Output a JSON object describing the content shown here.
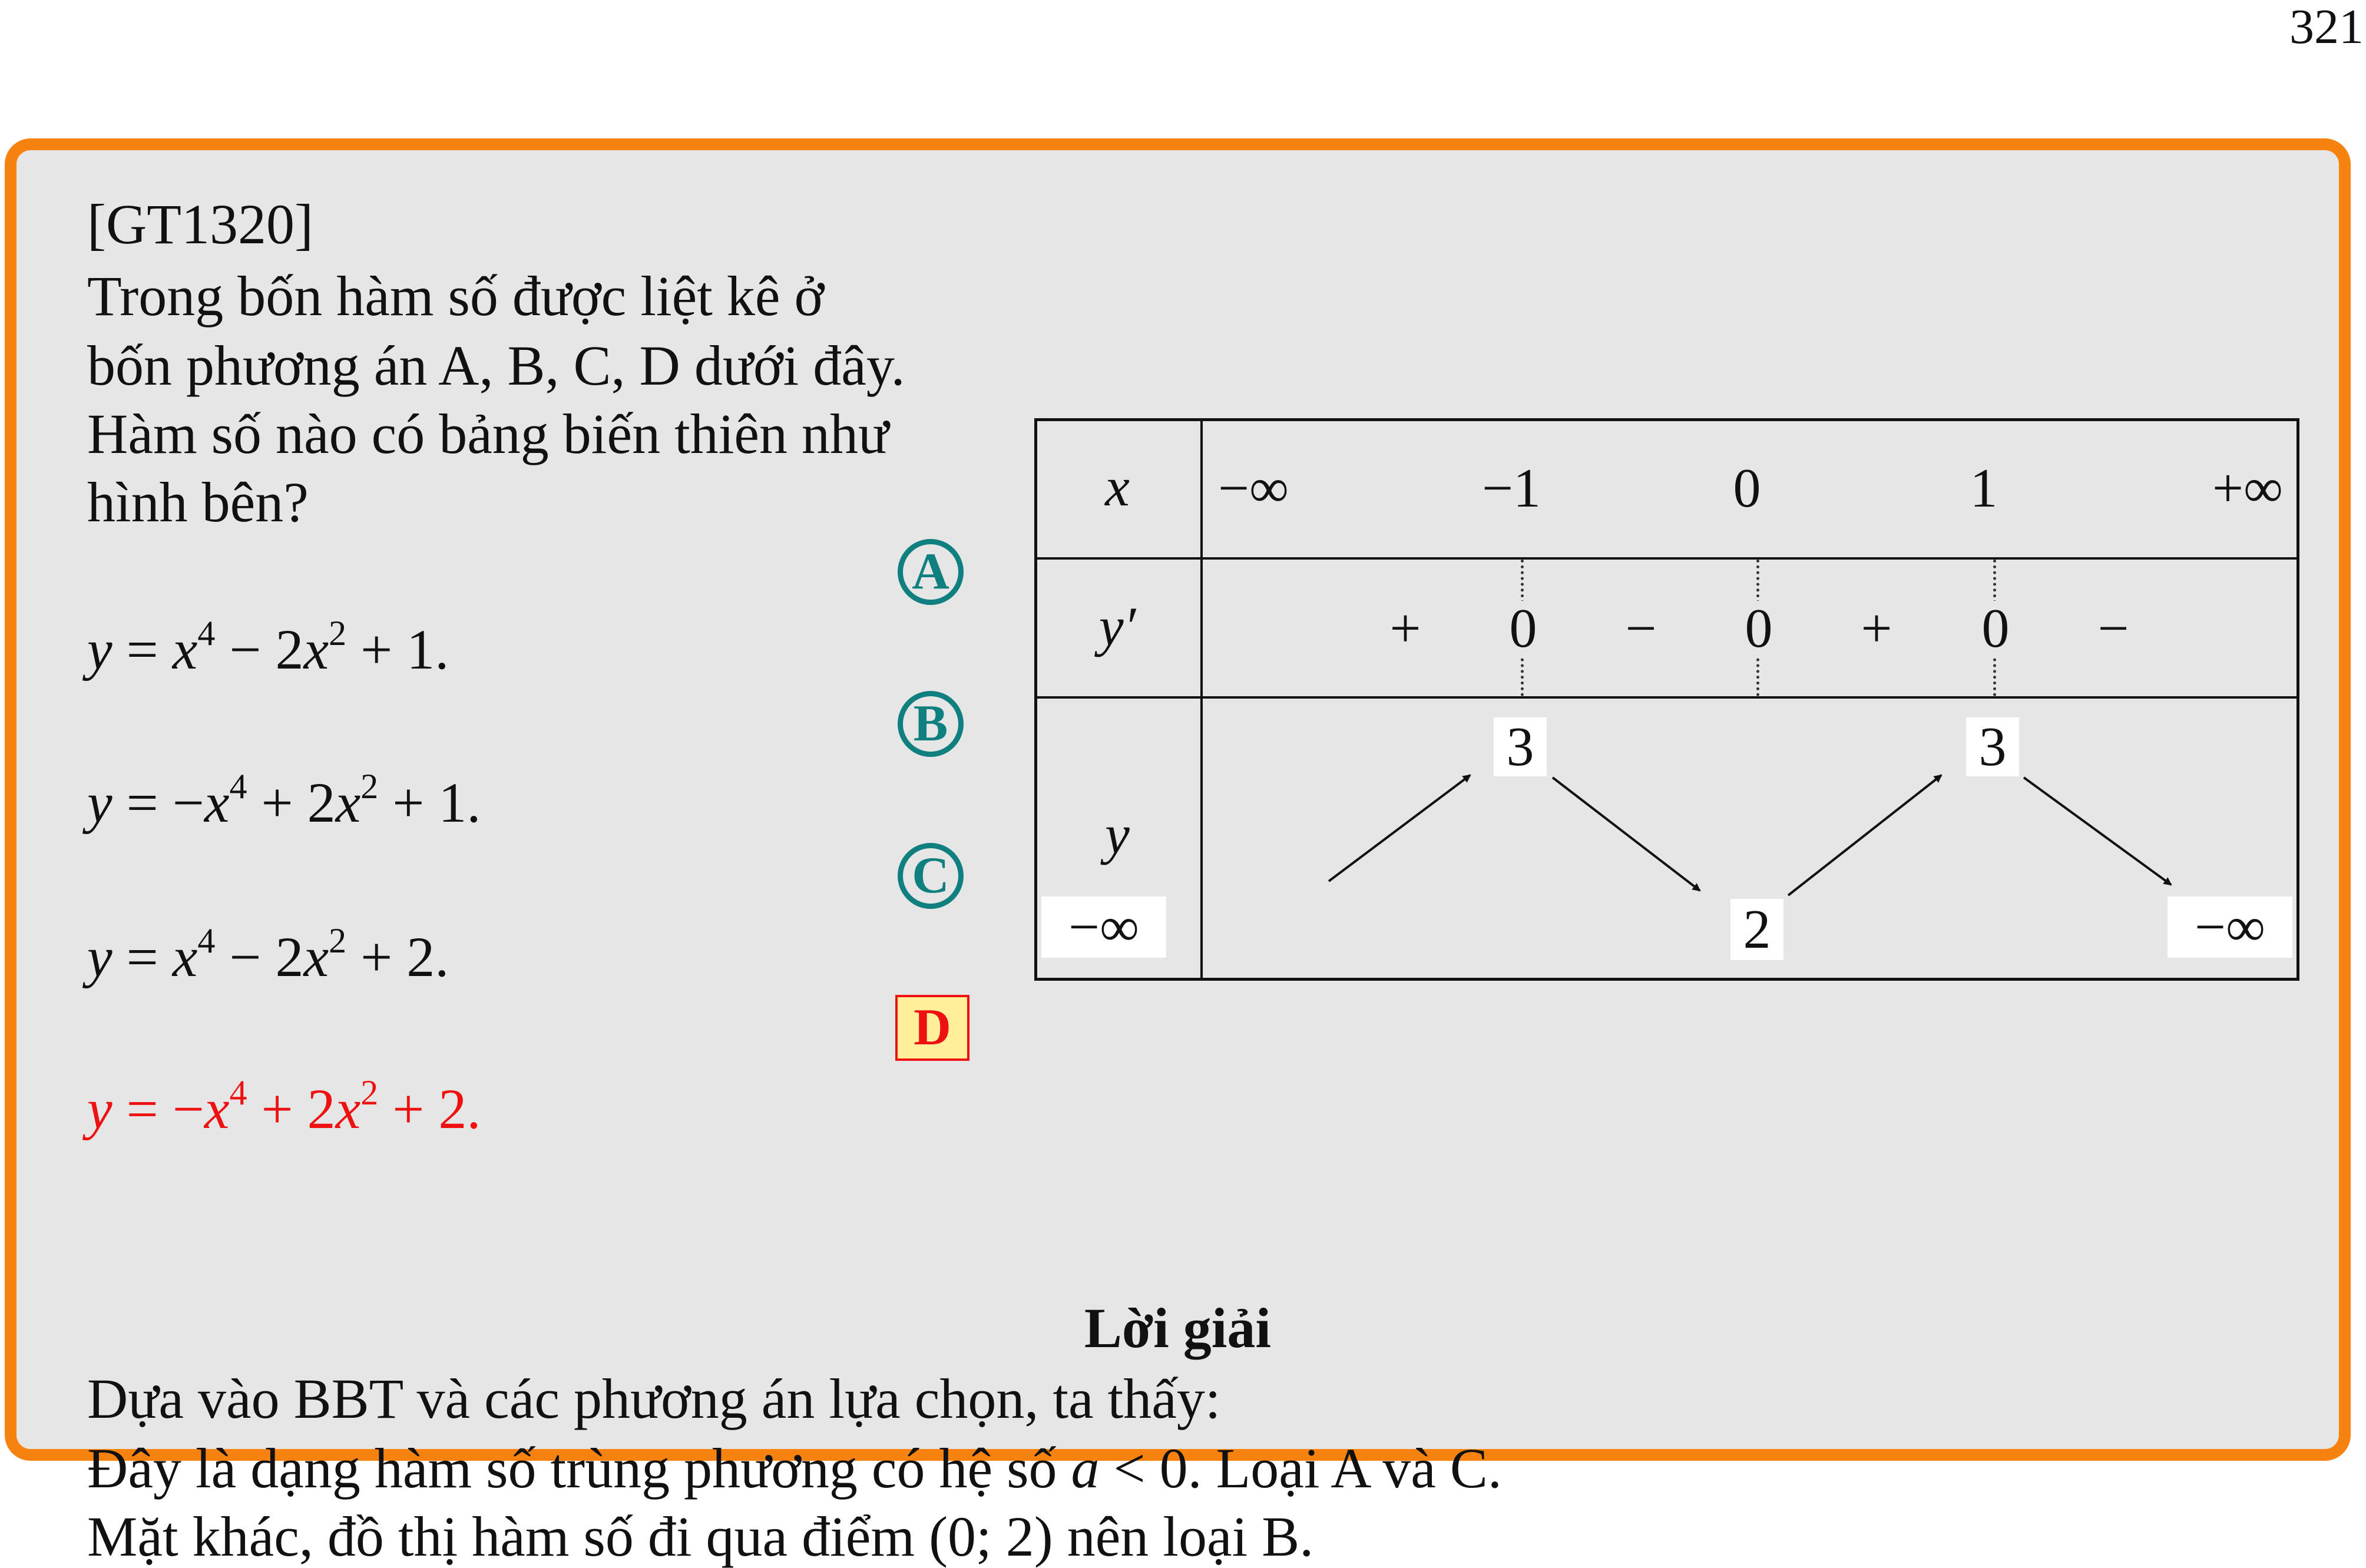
{
  "page_number": "321",
  "problem": {
    "code": "[GT1320]",
    "stem_lines": [
      "Trong bốn hàm số được liệt kê ở",
      "bốn phương án A, B, C, D dưới đây.",
      "Hàm số nào có bảng biến thiên như",
      "hình bên?"
    ],
    "choices": [
      {
        "label": "A",
        "formula": "y = x⁴ − 2x² + 1.",
        "correct": false
      },
      {
        "label": "B",
        "formula": "y = −x⁴ + 2x² + 1.",
        "correct": false
      },
      {
        "label": "C",
        "formula": "y = x⁴ − 2x² + 2.",
        "correct": false
      },
      {
        "label": "D",
        "formula": "y = −x⁴ + 2x² + 2.",
        "correct": true
      }
    ]
  },
  "variation_table": {
    "row_labels": [
      "x",
      "y′",
      "y"
    ],
    "x_values": [
      "−∞",
      "−1",
      "0",
      "1",
      "+∞"
    ],
    "derivative_signs": [
      "+",
      "0",
      "−",
      "0",
      "+",
      "0",
      "−"
    ],
    "y_values": {
      "bottom": [
        "−∞",
        "2",
        "−∞"
      ],
      "top": [
        "3",
        "3"
      ]
    }
  },
  "solution": {
    "title": "Lời giải",
    "lines": [
      "Dựa vào BBT và các phương án lựa chọn, ta thấy:",
      "Đây là dạng hàm số trùng phương có hệ số a < 0. Loại A và C.",
      "Mặt khác, đồ thị hàm số đi qua điểm (0; 2) nên loại B."
    ]
  },
  "colors": {
    "frame": "#f7820f",
    "box_background": "#e6e6e6",
    "choice_badge": "#0f7f7f",
    "correct": "#e11111",
    "correct_badge_fill": "#ffef9a"
  }
}
